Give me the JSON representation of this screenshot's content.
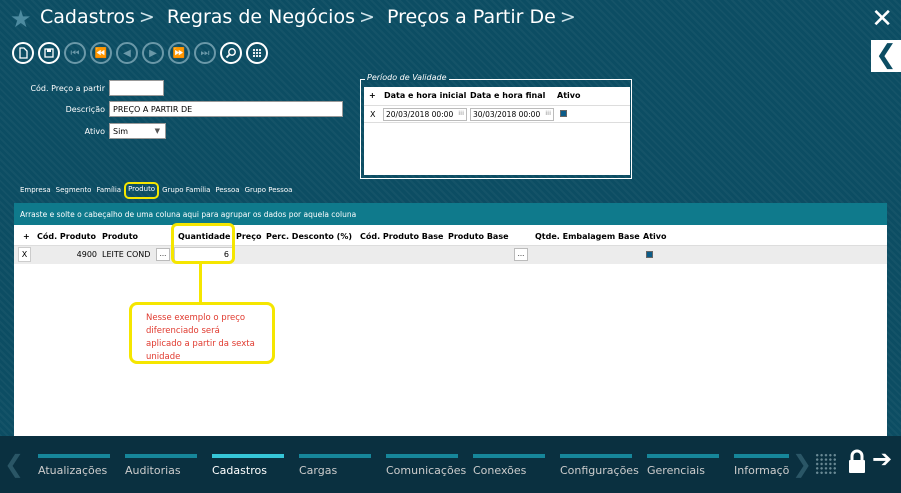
{
  "header": {
    "breadcrumb": [
      "Cadastros",
      "Regras de Negócios",
      "Preços a Partir De"
    ],
    "separator": ">"
  },
  "form": {
    "cod_label": "Cód. Preço a partir",
    "cod_value": "",
    "descricao_label": "Descrição",
    "descricao_value": "PREÇO A PARTIR DE",
    "ativo_label": "Ativo",
    "ativo_value": "Sim"
  },
  "periodo": {
    "title": "Período de Validade",
    "headers": {
      "add": "+",
      "inicio": "Data e hora inicial",
      "fim": "Data e hora final",
      "ativo": "Ativo"
    },
    "row": {
      "remove": "X",
      "inicio": "20/03/2018 00:00",
      "fim": "30/03/2018 00:00"
    }
  },
  "tabs": [
    "Empresa",
    "Segmento",
    "Família",
    "Produto",
    "Grupo Família",
    "Pessoa",
    "Grupo Pessoa"
  ],
  "grid": {
    "group_hint": "Arraste e solte o cabeçalho de uma coluna aqui para agrupar os dados por aquela coluna",
    "headers": {
      "add": "+",
      "cod_produto": "Cód. Produto",
      "produto": "Produto",
      "quantidade": "Quantidade",
      "preco": "Preço",
      "perc_desconto": "Perc. Desconto (%)",
      "cod_produto_base": "Cód. Produto Base",
      "produto_base": "Produto Base",
      "qtde_embalagem": "Qtde. Embalagem Base",
      "ativo": "Ativo"
    },
    "row": {
      "remove": "X",
      "cod_produto": "4900",
      "produto": "LEITE COND",
      "ellipsis": "...",
      "quantidade": "6",
      "ellipsis_base": "..."
    }
  },
  "callout": {
    "text": "Nesse exemplo o preço diferenciado será aplicado a partir da sexta unidade"
  },
  "bottom_nav": [
    "Atualizações",
    "Auditorias",
    "Cadastros",
    "Cargas",
    "Comunicações",
    "Conexões",
    "Configurações",
    "Gerenciais",
    "Informações"
  ],
  "colors": {
    "accent": "#0f7a8c",
    "highlight": "#f5e600",
    "callout_text": "#e03a2f"
  }
}
